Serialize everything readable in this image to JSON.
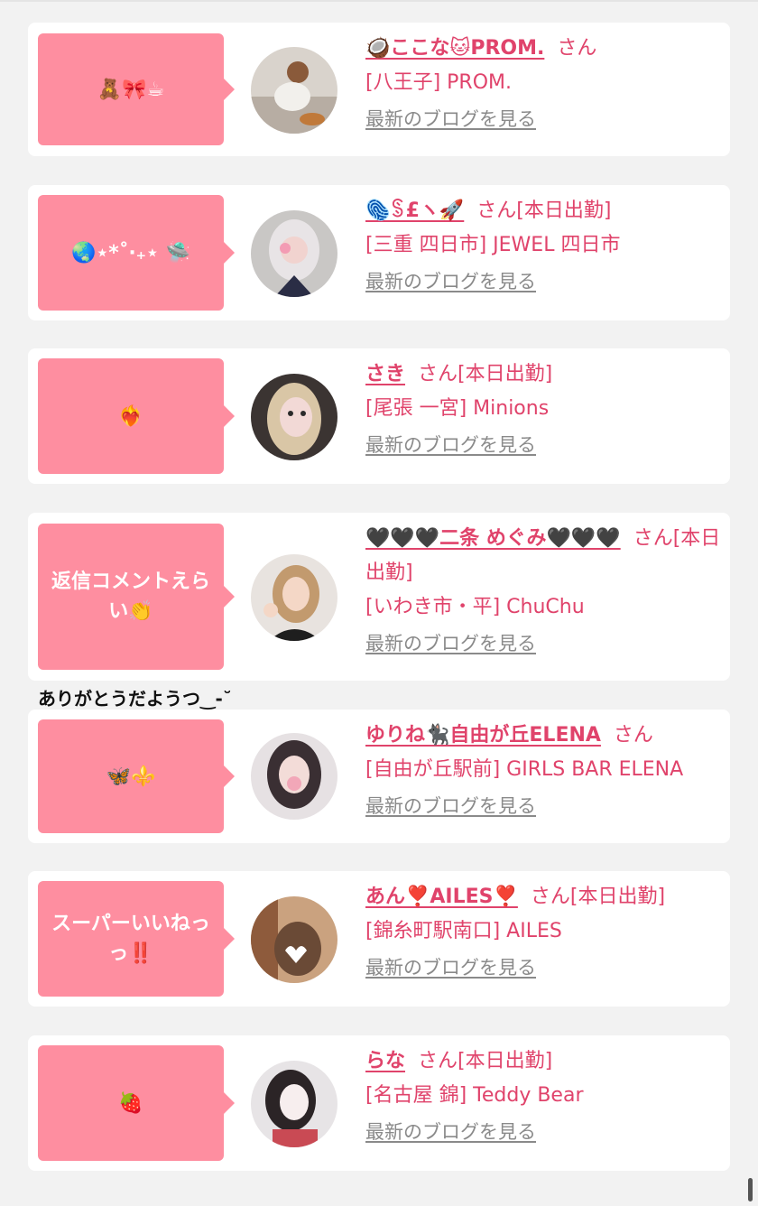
{
  "honorific": "さん",
  "blog_link_label": "最新のブログを見る",
  "colors": {
    "accent": "#e0436b",
    "bubble": "#fe8ea0",
    "muted": "#8a8a8a"
  },
  "entries": [
    {
      "comment": "🧸🎀☕",
      "name": "🥥ここな🐱PROM.",
      "status": "",
      "shop": "[八王子] PROM."
    },
    {
      "comment": "🌏⋆*˚‧₊⋆ 🛸",
      "name": "🫆ꌗ£ヽ🚀",
      "status": "[本日出勤]",
      "shop": "[三重 四日市] JEWEL 四日市"
    },
    {
      "comment": "❤️‍🔥",
      "name": "さき",
      "status": "[本日出勤]",
      "shop": "[尾張 一宮] Minions"
    },
    {
      "comment": "返信コメントえらい👏",
      "name": "🖤🖤🖤二条 めぐみ🖤🖤🖤",
      "status": "[本日出勤]",
      "shop": "[いわき市・平] ChuChu"
    },
    {
      "comment": "🦋⚜️",
      "name": "ゆりね🐈‍⬛自由が丘ELENA",
      "status": "",
      "shop": "[自由が丘駅前] GIRLS BAR ELENA"
    },
    {
      "comment": "スーパーいいねっっ‼️",
      "name": "あん❣️AILES❣️",
      "status": "[本日出勤]",
      "shop": "[錦糸町駅南口] AILES"
    },
    {
      "comment": "🍓",
      "name": "らな",
      "status": "[本日出勤]",
      "shop": "[名古屋 錦] Teddy Bear"
    }
  ],
  "reply_note": "ありがとうだようつ‿-˘"
}
